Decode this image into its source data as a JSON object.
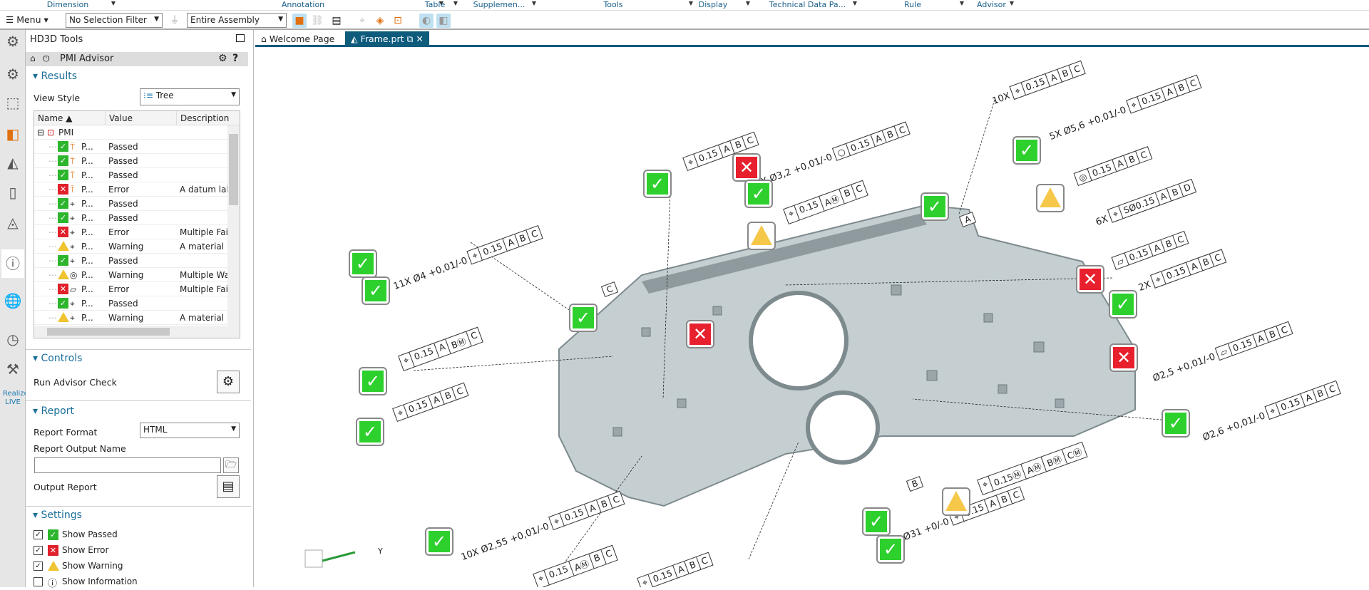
{
  "ribbon": {
    "groups": [
      "Dimension",
      "Annotation",
      "Table",
      "Supplemen...",
      "Tools",
      "Display",
      "Technical Data Pa...",
      "Rule",
      "Advisor"
    ]
  },
  "toolbar": {
    "menu_label": "Menu",
    "selection_filter": "No Selection Filter",
    "scope": "Entire Assembly"
  },
  "panel": {
    "title": "HD3D Tools",
    "tool_name": "PMI Advisor",
    "results": {
      "header": "Results",
      "view_style_label": "View Style",
      "view_style_value": "Tree",
      "columns": [
        "Name",
        "Value",
        "Description"
      ],
      "root": "PMI",
      "rows": [
        {
          "status": "passed",
          "icon": "datum",
          "name": "P...",
          "value": "Passed",
          "description": ""
        },
        {
          "status": "passed",
          "icon": "datum",
          "name": "P...",
          "value": "Passed",
          "description": ""
        },
        {
          "status": "passed",
          "icon": "datum",
          "name": "P...",
          "value": "Passed",
          "description": ""
        },
        {
          "status": "error",
          "icon": "datum",
          "name": "P...",
          "value": "Error",
          "description": "A datum lab"
        },
        {
          "status": "passed",
          "icon": "position",
          "name": "P...",
          "value": "Passed",
          "description": ""
        },
        {
          "status": "passed",
          "icon": "position",
          "name": "P...",
          "value": "Passed",
          "description": ""
        },
        {
          "status": "error",
          "icon": "position",
          "name": "P...",
          "value": "Error",
          "description": "Multiple Fail"
        },
        {
          "status": "warning",
          "icon": "position",
          "name": "P...",
          "value": "Warning",
          "description": "A material m"
        },
        {
          "status": "passed",
          "icon": "position",
          "name": "P...",
          "value": "Passed",
          "description": ""
        },
        {
          "status": "warning",
          "icon": "concentricity",
          "name": "P...",
          "value": "Warning",
          "description": "Multiple Wa"
        },
        {
          "status": "error",
          "icon": "flatness",
          "name": "P...",
          "value": "Error",
          "description": "Multiple Fail"
        },
        {
          "status": "passed",
          "icon": "position",
          "name": "P...",
          "value": "Passed",
          "description": ""
        },
        {
          "status": "warning",
          "icon": "position",
          "name": "P...",
          "value": "Warning",
          "description": "A material m"
        }
      ]
    },
    "controls": {
      "header": "Controls",
      "run_label": "Run Advisor Check"
    },
    "report": {
      "header": "Report",
      "format_label": "Report Format",
      "format_value": "HTML",
      "output_name_label": "Report Output Name",
      "output_name_value": "",
      "output_report_label": "Output Report"
    },
    "settings": {
      "header": "Settings",
      "items": [
        {
          "label": "Show Passed",
          "checked": true,
          "icon": "passed"
        },
        {
          "label": "Show Error",
          "checked": true,
          "icon": "error"
        },
        {
          "label": "Show Warning",
          "checked": true,
          "icon": "warning"
        },
        {
          "label": "Show Information",
          "checked": false,
          "icon": "info"
        }
      ]
    }
  },
  "tabs": [
    {
      "label": "Welcome Page",
      "active": false
    },
    {
      "label": "Frame.prt",
      "active": true
    }
  ],
  "viewport": {
    "markers": [
      "passed",
      "error",
      "passed",
      "warning",
      "passed",
      "passed",
      "warning",
      "passed",
      "passed",
      "passed",
      "error",
      "error",
      "passed",
      "error",
      "passed",
      "passed",
      "passed",
      "warning",
      "passed",
      "passed",
      "passed"
    ],
    "annotations": [
      {
        "pre": "10X",
        "cells": [
          "⌖",
          "0.15",
          "A",
          "B",
          "C"
        ]
      },
      {
        "pre": "5X  Ø5,6 +0,01/-0",
        "cells": [
          "⌖",
          "0.15",
          "A",
          "B",
          "C"
        ]
      },
      {
        "pre": "",
        "cells": [
          "◎",
          "0.15",
          "A",
          "B",
          "C"
        ]
      },
      {
        "pre": "6X",
        "cells": [
          "⌖",
          "SØ0.15",
          "A",
          "B",
          "D"
        ]
      },
      {
        "pre": "",
        "cells": [
          "▱",
          "0.15",
          "A",
          "B",
          "C"
        ]
      },
      {
        "pre": "2X",
        "cells": [
          "⌖",
          "0.15",
          "A",
          "B",
          "C"
        ]
      },
      {
        "pre": "Ø2,5 +0,01/-0",
        "cells": [
          "▱",
          "0.15",
          "A",
          "B",
          "C"
        ]
      },
      {
        "pre": "Ø2,6 +0,01/-0",
        "cells": [
          "⌖",
          "0.15",
          "A",
          "B",
          "C"
        ]
      },
      {
        "pre": "",
        "cells": [
          "⌖",
          "0.15Ⓜ",
          "AⓂ",
          "BⓂ",
          "CⓂ"
        ]
      },
      {
        "pre": "Ø31 +0/-0",
        "cells": [
          "⌖",
          "0.15",
          "A",
          "B",
          "C"
        ]
      },
      {
        "pre": "10X  Ø2,55 +0,01/-0",
        "cells": [
          "⌖",
          "0.15",
          "A",
          "B",
          "C"
        ]
      },
      {
        "pre": "",
        "cells": [
          "⌖",
          "0.15",
          "AⓂ",
          "B",
          "C"
        ]
      },
      {
        "pre": "",
        "cells": [
          "⌖",
          "0.15",
          "A",
          "B",
          "C"
        ]
      },
      {
        "pre": "11X  Ø4 +0,01/-0",
        "cells": [
          "⌖",
          "0.15",
          "A",
          "B",
          "C"
        ]
      },
      {
        "pre": "",
        "cells": [
          "⌖",
          "0.15",
          "A",
          "BⓂ",
          "C"
        ]
      },
      {
        "pre": "",
        "cells": [
          "⌖",
          "0.15",
          "A",
          "B",
          "C"
        ]
      },
      {
        "pre": "",
        "cells": [
          "⌖",
          "0.15",
          "A",
          "B",
          "C"
        ]
      },
      {
        "pre": "28X  Ø3,2 +0,01/-0",
        "cells": [
          "○",
          "0.15",
          "A",
          "B",
          "C"
        ]
      },
      {
        "pre": "",
        "cells": [
          "⌖",
          "0.15",
          "AⓂ",
          "B",
          "C"
        ]
      }
    ],
    "datums": [
      "C",
      "B",
      "A"
    ],
    "axis_label": "Y"
  }
}
